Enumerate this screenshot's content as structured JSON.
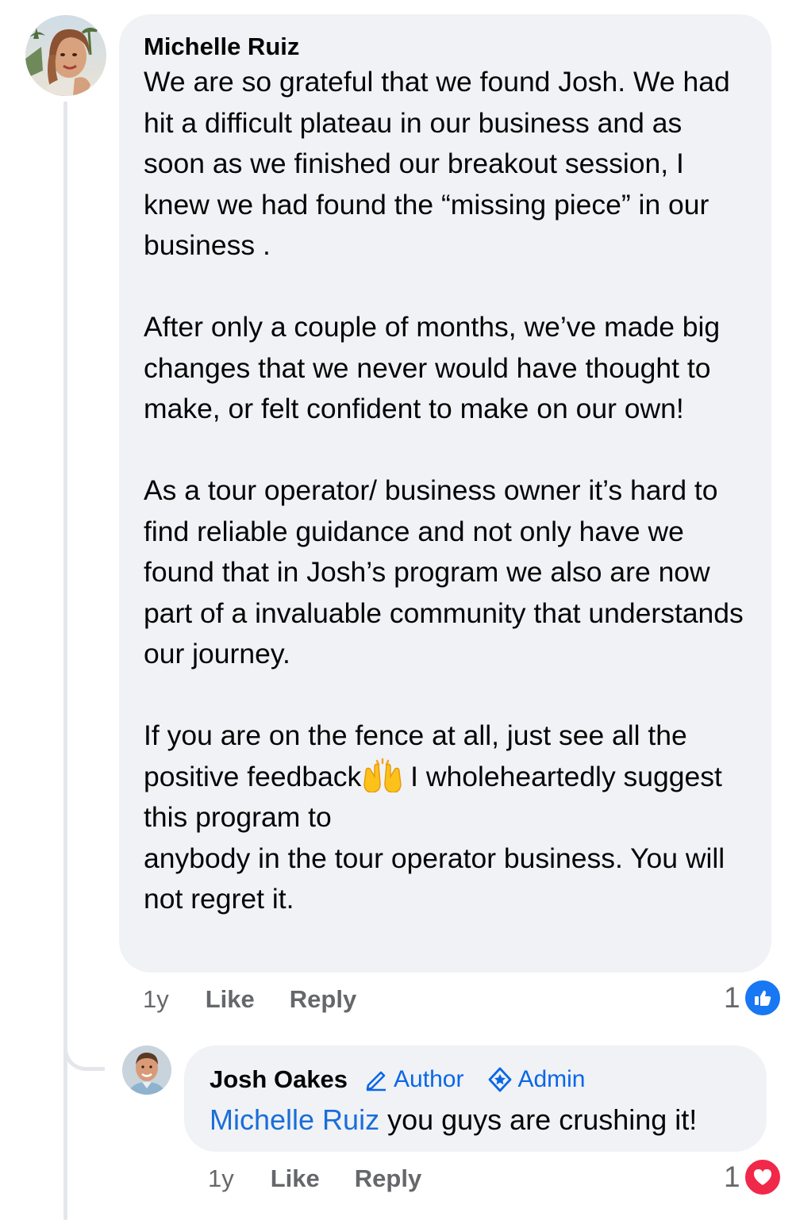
{
  "comment": {
    "author": "Michelle Ruiz",
    "paragraphs": [
      "We are so grateful that we found Josh. We had hit a difficult plateau in our business and as soon as we finished our breakout session, I  knew we had found the “missing piece” in our business .",
      "After only a couple of months, we’ve made big changes that we never would have thought to make, or felt confident to make on our own!",
      "As a tour operator/ business owner it’s hard to find reliable guidance and not only have we found that in Josh’s program we also are now part of a invaluable community that understands our journey."
    ],
    "last_paragraph": {
      "before_emoji": "If you are on the fence at all, just see all the positive feedback",
      "emoji": "raising-hands-emoji",
      "after_emoji": " I wholeheartedly suggest this program to",
      "line_break_text": "anybody in the tour operator business. You will not regret it."
    },
    "time": "1y",
    "like_label": "Like",
    "reply_label": "Reply",
    "reaction_count": "1",
    "reaction_icon": "like-icon",
    "reaction_color": "#1877f2"
  },
  "reply": {
    "author": "Josh Oakes",
    "badges": [
      {
        "label": "Author",
        "icon": "pencil-icon"
      },
      {
        "label": "Admin",
        "icon": "shield-star-icon"
      }
    ],
    "mention": "Michelle Ruiz",
    "text": " you guys are crushing it!",
    "time": "1y",
    "like_label": "Like",
    "reply_label": "Reply",
    "reaction_count": "1",
    "reaction_icon": "love-icon",
    "reaction_color": "#f0284a"
  }
}
